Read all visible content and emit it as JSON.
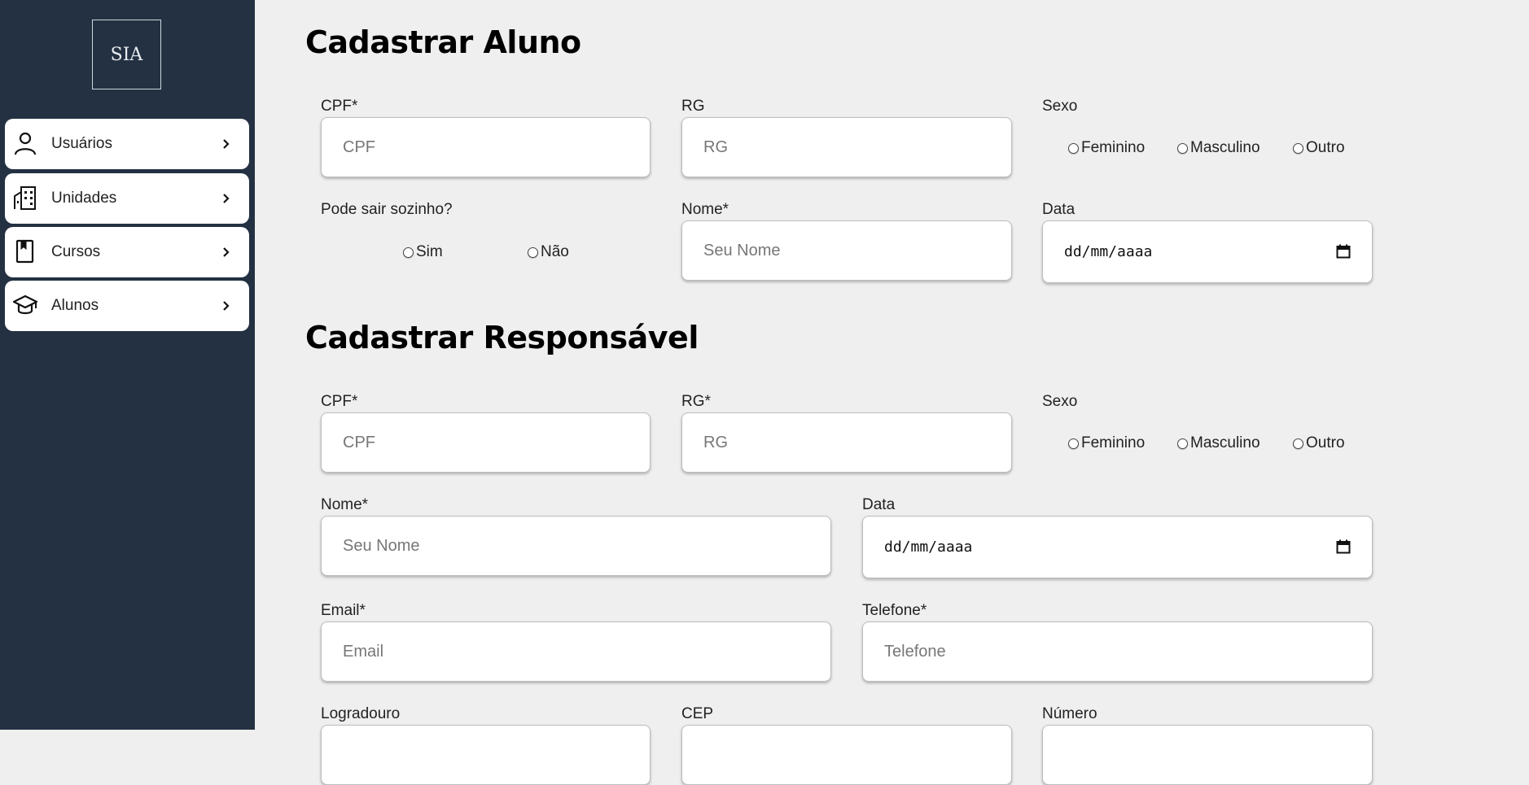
{
  "logo": "SIA",
  "sidebar": {
    "items": [
      {
        "label": "Usuários",
        "icon": "user-icon"
      },
      {
        "label": "Unidades",
        "icon": "building-icon"
      },
      {
        "label": "Cursos",
        "icon": "book-icon"
      },
      {
        "label": "Alunos",
        "icon": "graduation-cap-icon"
      }
    ]
  },
  "aluno": {
    "title": "Cadastrar Aluno",
    "cpf_label": "CPF*",
    "cpf_placeholder": "CPF",
    "rg_label": "RG",
    "rg_placeholder": "RG",
    "sexo_label": "Sexo",
    "sexo_options": [
      "Feminino",
      "Masculino",
      "Outro"
    ],
    "sair_label": "Pode sair sozinho?",
    "sair_options": [
      "Sim",
      "Não"
    ],
    "nome_label": "Nome*",
    "nome_placeholder": "Seu Nome",
    "data_label": "Data",
    "data_value": "dd/mm/aaaa"
  },
  "responsavel": {
    "title": "Cadastrar Responsável",
    "cpf_label": "CPF*",
    "cpf_placeholder": "CPF",
    "rg_label": "RG*",
    "rg_placeholder": "RG",
    "sexo_label": "Sexo",
    "sexo_options": [
      "Feminino",
      "Masculino",
      "Outro"
    ],
    "nome_label": "Nome*",
    "nome_placeholder": "Seu Nome",
    "data_label": "Data",
    "data_value": "dd/mm/aaaa",
    "email_label": "Email*",
    "email_placeholder": "Email",
    "telefone_label": "Telefone*",
    "telefone_placeholder": "Telefone",
    "logradouro_label": "Logradouro",
    "cep_label": "CEP",
    "numero_label": "Número"
  },
  "colors": {
    "sidebar_bg": "#233142",
    "page_bg": "#efefef"
  }
}
